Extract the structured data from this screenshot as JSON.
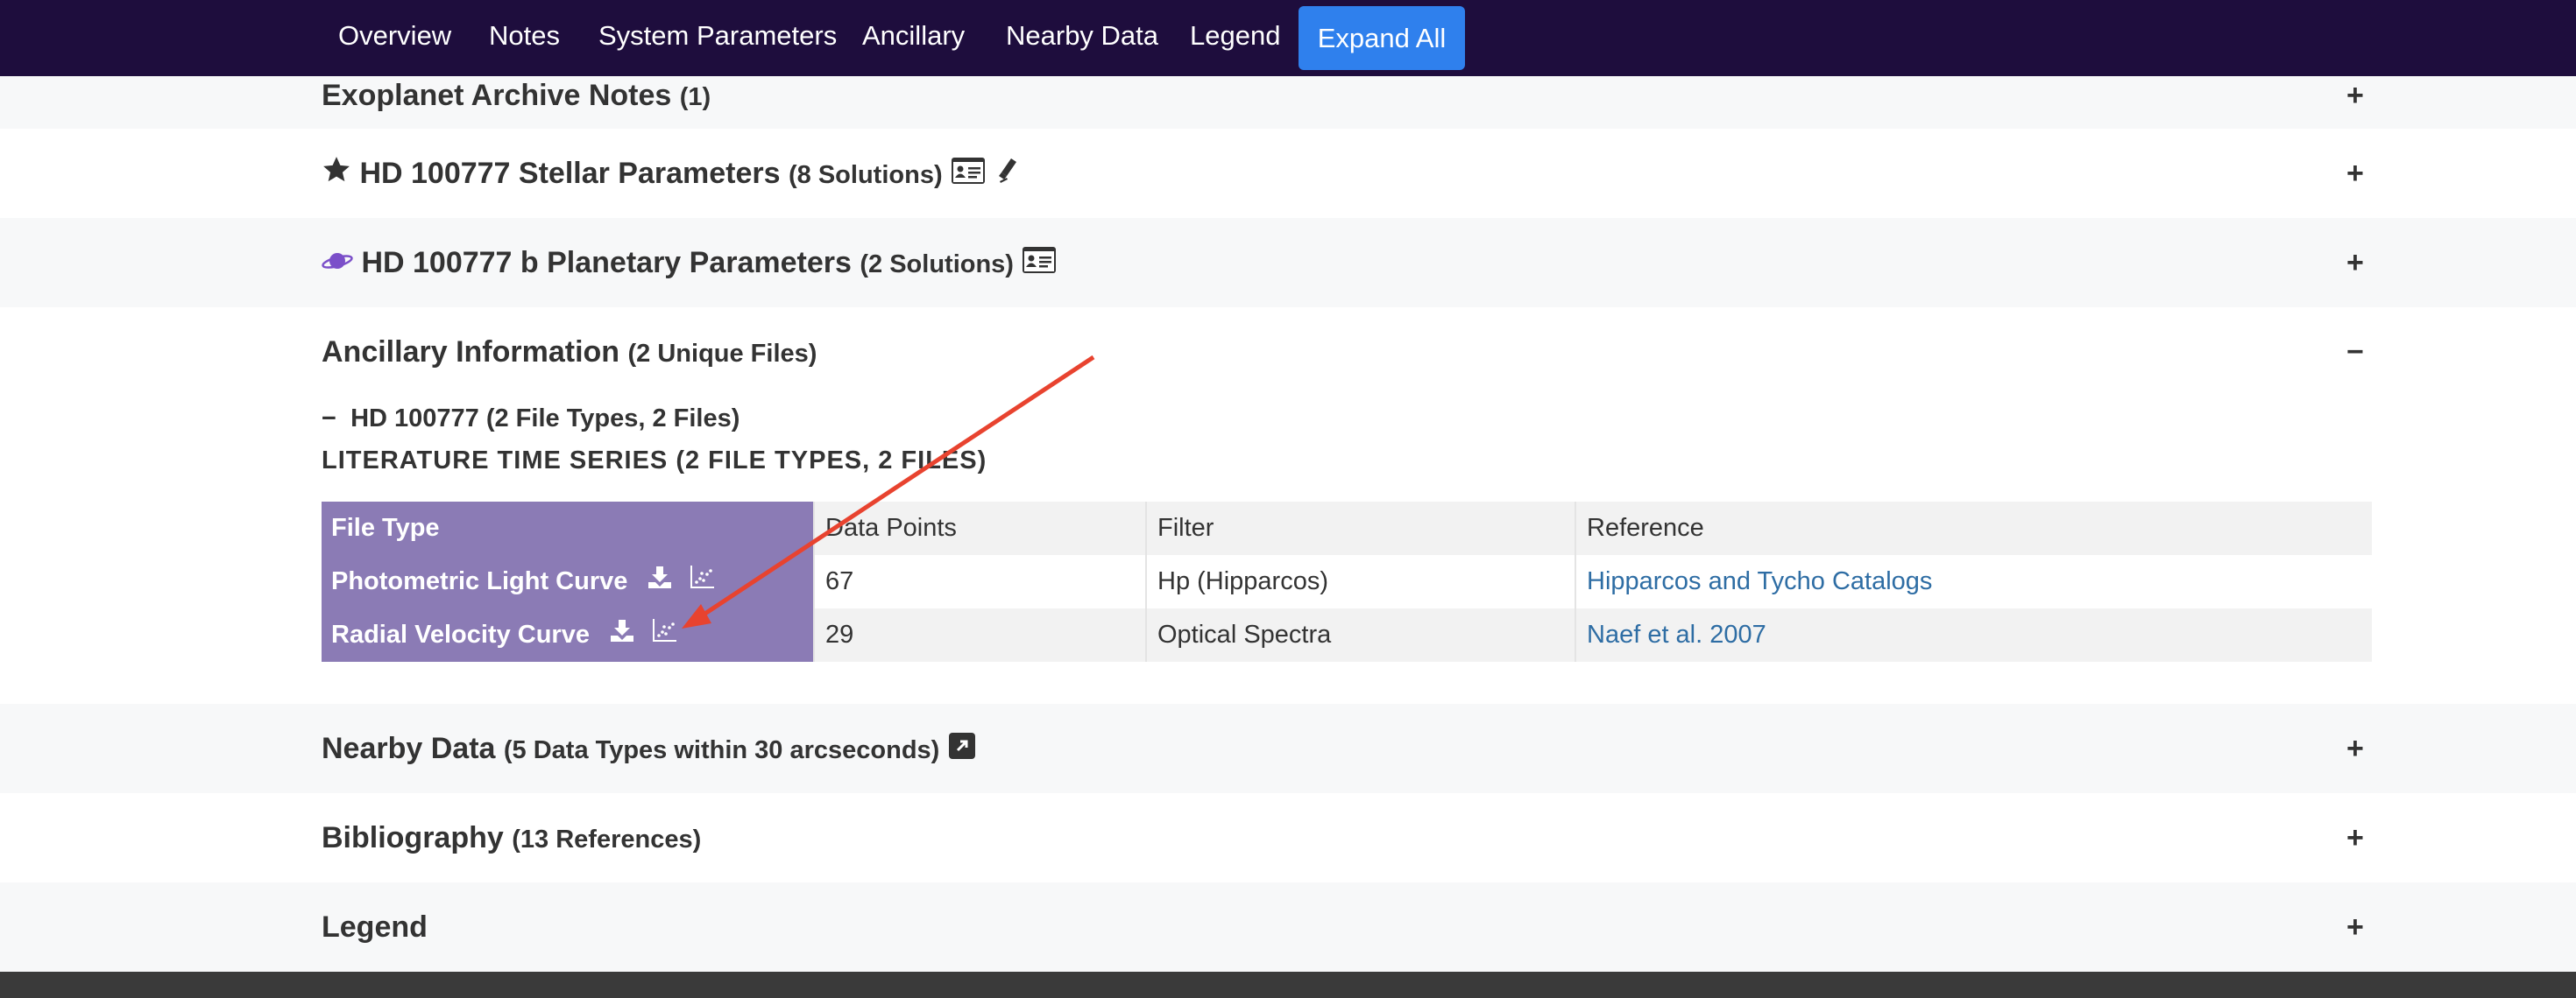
{
  "nav": {
    "items": [
      "Overview",
      "Notes",
      "System Parameters",
      "Ancillary",
      "Nearby Data",
      "Legend"
    ],
    "expand_all": "Expand All"
  },
  "sections": {
    "notes": {
      "title": "Exoplanet Archive Notes",
      "sub": "(1)",
      "toggle": "+"
    },
    "stellar": {
      "title": "HD 100777 Stellar Parameters",
      "sub": "(8 Solutions)",
      "toggle": "+"
    },
    "planetary": {
      "title": "HD 100777 b Planetary Parameters",
      "sub": "(2 Solutions)",
      "toggle": "+"
    },
    "ancillary": {
      "title": "Ancillary Information",
      "sub": "(2 Unique Files)",
      "toggle": "−"
    },
    "nearby": {
      "title": "Nearby Data",
      "sub": "(5 Data Types within 30 arcseconds)",
      "toggle": "+"
    },
    "bibliography": {
      "title": "Bibliography",
      "sub": "(13 References)",
      "toggle": "+"
    },
    "legend": {
      "title": "Legend",
      "toggle": "+"
    }
  },
  "ancillary": {
    "object_toggle": "−",
    "object_line": "HD 100777 (2 File Types, 2 Files)",
    "series_heading": "LITERATURE TIME SERIES (2 FILE TYPES, 2 FILES)",
    "table": {
      "headers": [
        "File Type",
        "Data Points",
        "Filter",
        "Reference"
      ],
      "rows": [
        {
          "file_type": "Photometric Light Curve",
          "data_points": "67",
          "filter": "Hp (Hipparcos)",
          "reference": "Hipparcos and Tycho Catalogs"
        },
        {
          "file_type": "Radial Velocity Curve",
          "data_points": "29",
          "filter": "Optical Spectra",
          "reference": "Naef et al. 2007"
        }
      ]
    }
  },
  "colors": {
    "nav_bg": "#1e0d3d",
    "expand_button": "#2f80ed",
    "file_type_column": "#8b7bb5",
    "link": "#2e6da4",
    "annotation_arrow": "#e8432f",
    "planet_icon": "#7b4fc9"
  },
  "icons": [
    "star-icon",
    "id-card-icon",
    "telescope-icon",
    "planet-icon",
    "external-link-icon",
    "download-icon",
    "plot-icon"
  ]
}
